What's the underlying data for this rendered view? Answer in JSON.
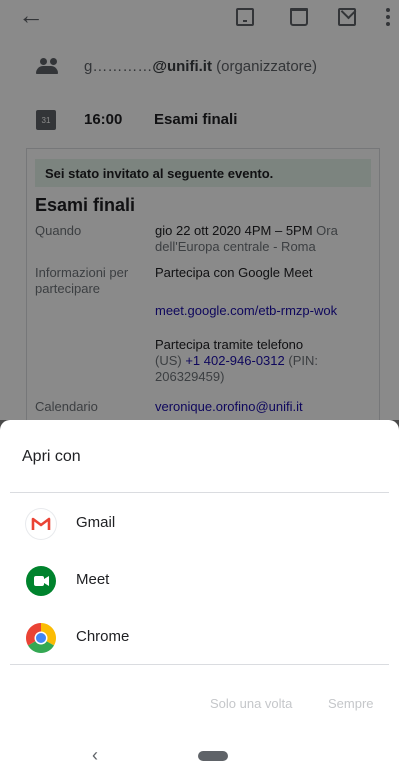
{
  "email": {
    "organizer_hidden": "g…………",
    "organizer_domain": "@unifi.it",
    "organizer_role": " (organizzatore)",
    "time": "16:00",
    "subject": "Esami finali",
    "calendar_icon_day": "31",
    "banner": "Sei stato invitato al seguente evento.",
    "event_title": "Esami finali",
    "when_label": "Quando",
    "when_value": "gio 22 ott 2020 4PM – 5PM",
    "when_tz": " Ora dell'Europa centrale - Roma",
    "info_label": "Informazioni per partecipare",
    "meet_join": "Partecipa con Google Meet",
    "meet_link": "meet.google.com/etb-rmzp-wok",
    "phone_join": "Partecipa tramite telefono",
    "phone_country": "(US) ",
    "phone_number": "+1 402-946-0312",
    "phone_pin": " (PIN: 206329459)",
    "calendar_label": "Calendario",
    "calendar_value": "veronique.orofino@unifi.it"
  },
  "sheet": {
    "title": "Apri con",
    "apps": [
      {
        "label": "Gmail",
        "icon": "gmail-icon"
      },
      {
        "label": "Meet",
        "icon": "meet-icon"
      },
      {
        "label": "Chrome",
        "icon": "chrome-icon"
      }
    ],
    "once_label": "Solo una volta",
    "always_label": "Sempre"
  },
  "colors": {
    "link": "#1a0dab",
    "banner_bg": "#e6f4ea",
    "scrim": "rgba(0,0,0,0.46)"
  }
}
